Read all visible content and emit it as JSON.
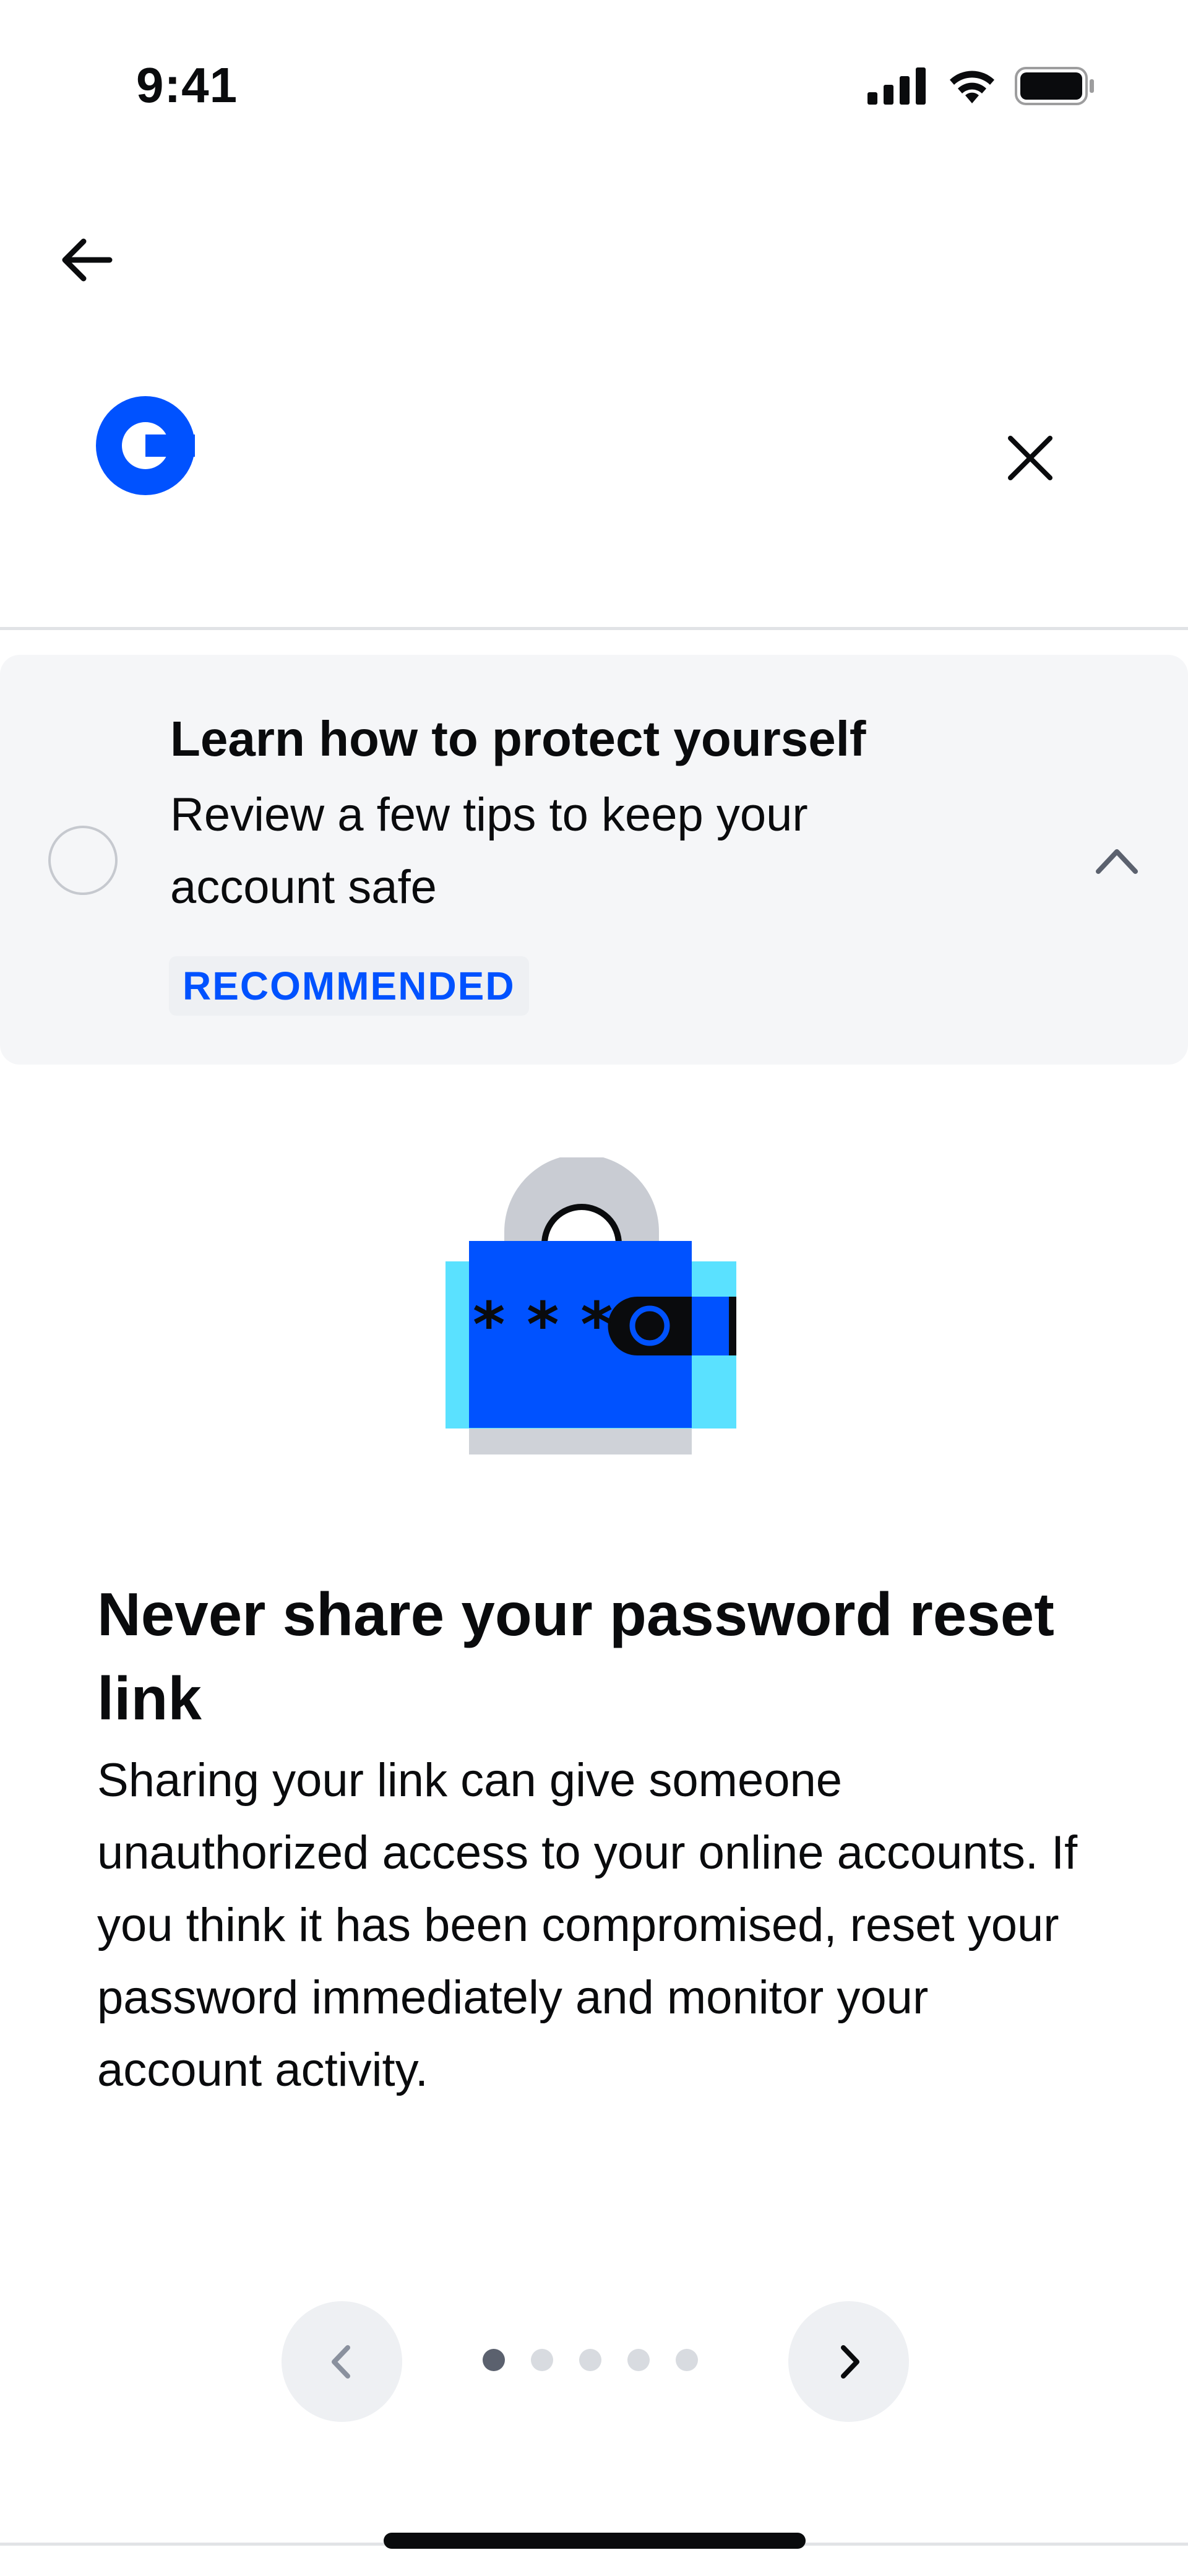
{
  "status_bar": {
    "time": "9:41",
    "icons": [
      "cellular-signal-icon",
      "wifi-icon",
      "battery-icon"
    ]
  },
  "nav": {
    "back_icon": "arrow-left-icon",
    "logo_icon": "coinbase-logo-icon",
    "close_icon": "close-icon"
  },
  "checklist_card": {
    "title": "Learn how to protect yourself",
    "description": "Review a few tips to keep your account safe",
    "badge": "RECOMMENDED",
    "expanded": true
  },
  "tip": {
    "title": "Never share your password reset link",
    "body": "Sharing your link can give someone unauthorized access to your online accounts. If you think it has been compromised, reset your password immediately and monitor your account activity.",
    "illustration_mask": "* * *"
  },
  "pager": {
    "current_page": 1,
    "total_pages": 5
  },
  "colors": {
    "brand_blue": "#0052ff",
    "card_bg": "#f5f6f8",
    "accent_cyan": "#5ae1ff"
  }
}
